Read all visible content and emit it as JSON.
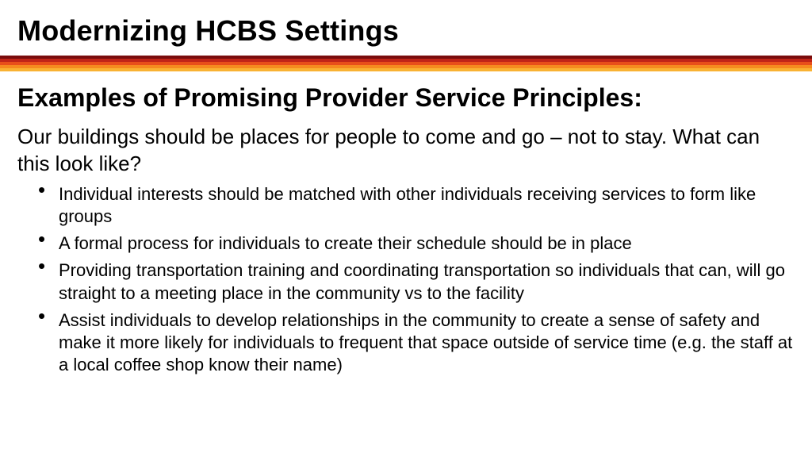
{
  "title": "Modernizing HCBS Settings",
  "stripe_colors": [
    "#7a0c0c",
    "#c02418",
    "#e84e1a",
    "#f58a1f",
    "#f9b233"
  ],
  "subtitle": "Examples of Promising Provider Service Principles:",
  "lead": "Our buildings should be places for people to come and go – not to stay.  What can this look like?",
  "bullets": [
    "Individual interests should be matched with other individuals receiving services to form like groups",
    "A formal process for individuals to create their schedule should be in place",
    "Providing transportation training and coordinating transportation so individuals that can, will go straight to a meeting place in the community vs to the facility",
    "Assist individuals to develop relationships in the community to create a sense of safety and make it more likely for individuals to frequent that space outside of service time (e.g. the staff at a local coffee shop know their name)"
  ]
}
